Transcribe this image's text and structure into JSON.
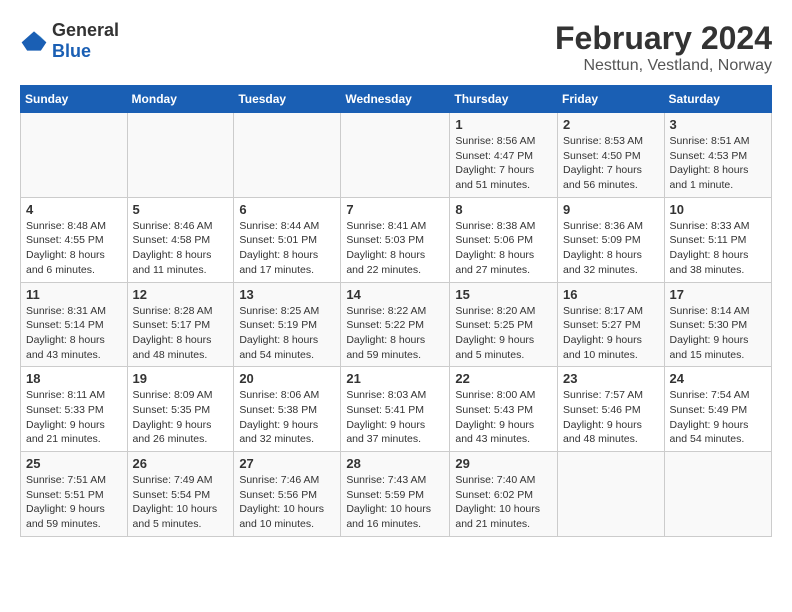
{
  "logo": {
    "text_general": "General",
    "text_blue": "Blue"
  },
  "title": "February 2024",
  "subtitle": "Nesttun, Vestland, Norway",
  "days_of_week": [
    "Sunday",
    "Monday",
    "Tuesday",
    "Wednesday",
    "Thursday",
    "Friday",
    "Saturday"
  ],
  "weeks": [
    [
      {
        "day": "",
        "info": ""
      },
      {
        "day": "",
        "info": ""
      },
      {
        "day": "",
        "info": ""
      },
      {
        "day": "",
        "info": ""
      },
      {
        "day": "1",
        "info": "Sunrise: 8:56 AM\nSunset: 4:47 PM\nDaylight: 7 hours\nand 51 minutes."
      },
      {
        "day": "2",
        "info": "Sunrise: 8:53 AM\nSunset: 4:50 PM\nDaylight: 7 hours\nand 56 minutes."
      },
      {
        "day": "3",
        "info": "Sunrise: 8:51 AM\nSunset: 4:53 PM\nDaylight: 8 hours\nand 1 minute."
      }
    ],
    [
      {
        "day": "4",
        "info": "Sunrise: 8:48 AM\nSunset: 4:55 PM\nDaylight: 8 hours\nand 6 minutes."
      },
      {
        "day": "5",
        "info": "Sunrise: 8:46 AM\nSunset: 4:58 PM\nDaylight: 8 hours\nand 11 minutes."
      },
      {
        "day": "6",
        "info": "Sunrise: 8:44 AM\nSunset: 5:01 PM\nDaylight: 8 hours\nand 17 minutes."
      },
      {
        "day": "7",
        "info": "Sunrise: 8:41 AM\nSunset: 5:03 PM\nDaylight: 8 hours\nand 22 minutes."
      },
      {
        "day": "8",
        "info": "Sunrise: 8:38 AM\nSunset: 5:06 PM\nDaylight: 8 hours\nand 27 minutes."
      },
      {
        "day": "9",
        "info": "Sunrise: 8:36 AM\nSunset: 5:09 PM\nDaylight: 8 hours\nand 32 minutes."
      },
      {
        "day": "10",
        "info": "Sunrise: 8:33 AM\nSunset: 5:11 PM\nDaylight: 8 hours\nand 38 minutes."
      }
    ],
    [
      {
        "day": "11",
        "info": "Sunrise: 8:31 AM\nSunset: 5:14 PM\nDaylight: 8 hours\nand 43 minutes."
      },
      {
        "day": "12",
        "info": "Sunrise: 8:28 AM\nSunset: 5:17 PM\nDaylight: 8 hours\nand 48 minutes."
      },
      {
        "day": "13",
        "info": "Sunrise: 8:25 AM\nSunset: 5:19 PM\nDaylight: 8 hours\nand 54 minutes."
      },
      {
        "day": "14",
        "info": "Sunrise: 8:22 AM\nSunset: 5:22 PM\nDaylight: 8 hours\nand 59 minutes."
      },
      {
        "day": "15",
        "info": "Sunrise: 8:20 AM\nSunset: 5:25 PM\nDaylight: 9 hours\nand 5 minutes."
      },
      {
        "day": "16",
        "info": "Sunrise: 8:17 AM\nSunset: 5:27 PM\nDaylight: 9 hours\nand 10 minutes."
      },
      {
        "day": "17",
        "info": "Sunrise: 8:14 AM\nSunset: 5:30 PM\nDaylight: 9 hours\nand 15 minutes."
      }
    ],
    [
      {
        "day": "18",
        "info": "Sunrise: 8:11 AM\nSunset: 5:33 PM\nDaylight: 9 hours\nand 21 minutes."
      },
      {
        "day": "19",
        "info": "Sunrise: 8:09 AM\nSunset: 5:35 PM\nDaylight: 9 hours\nand 26 minutes."
      },
      {
        "day": "20",
        "info": "Sunrise: 8:06 AM\nSunset: 5:38 PM\nDaylight: 9 hours\nand 32 minutes."
      },
      {
        "day": "21",
        "info": "Sunrise: 8:03 AM\nSunset: 5:41 PM\nDaylight: 9 hours\nand 37 minutes."
      },
      {
        "day": "22",
        "info": "Sunrise: 8:00 AM\nSunset: 5:43 PM\nDaylight: 9 hours\nand 43 minutes."
      },
      {
        "day": "23",
        "info": "Sunrise: 7:57 AM\nSunset: 5:46 PM\nDaylight: 9 hours\nand 48 minutes."
      },
      {
        "day": "24",
        "info": "Sunrise: 7:54 AM\nSunset: 5:49 PM\nDaylight: 9 hours\nand 54 minutes."
      }
    ],
    [
      {
        "day": "25",
        "info": "Sunrise: 7:51 AM\nSunset: 5:51 PM\nDaylight: 9 hours\nand 59 minutes."
      },
      {
        "day": "26",
        "info": "Sunrise: 7:49 AM\nSunset: 5:54 PM\nDaylight: 10 hours\nand 5 minutes."
      },
      {
        "day": "27",
        "info": "Sunrise: 7:46 AM\nSunset: 5:56 PM\nDaylight: 10 hours\nand 10 minutes."
      },
      {
        "day": "28",
        "info": "Sunrise: 7:43 AM\nSunset: 5:59 PM\nDaylight: 10 hours\nand 16 minutes."
      },
      {
        "day": "29",
        "info": "Sunrise: 7:40 AM\nSunset: 6:02 PM\nDaylight: 10 hours\nand 21 minutes."
      },
      {
        "day": "",
        "info": ""
      },
      {
        "day": "",
        "info": ""
      }
    ]
  ]
}
